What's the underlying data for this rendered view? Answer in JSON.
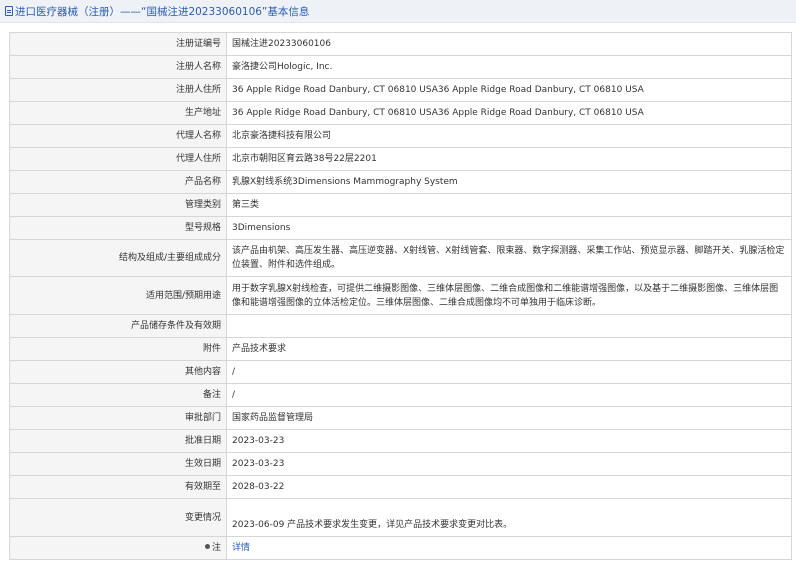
{
  "header": {
    "title": "进口医疗器械（注册）——“国械注进20233060106”基本信息"
  },
  "rows": [
    {
      "label": "注册证编号",
      "value": "国械注进20233060106"
    },
    {
      "label": "注册人名称",
      "value": "豪洛捷公司Hologic, Inc."
    },
    {
      "label": "注册人住所",
      "value": "36 Apple Ridge Road Danbury, CT 06810 USA36 Apple Ridge Road Danbury, CT 06810 USA"
    },
    {
      "label": "生产地址",
      "value": "36 Apple Ridge Road Danbury, CT 06810 USA36 Apple Ridge Road Danbury, CT 06810 USA"
    },
    {
      "label": "代理人名称",
      "value": "北京豪洛捷科技有限公司"
    },
    {
      "label": "代理人住所",
      "value": "北京市朝阳区育云路38号22层2201"
    },
    {
      "label": "产品名称",
      "value": "乳腺X射线系统3Dimensions Mammography System"
    },
    {
      "label": "管理类别",
      "value": "第三类"
    },
    {
      "label": "型号规格",
      "value": "3Dimensions"
    },
    {
      "label": "结构及组成/主要组成成分",
      "value": "该产品由机架、高压发生器、高压逆变器、X射线管、X射线管套、限束器、数字探测器、采集工作站、预览显示器、脚踏开关、乳腺活检定位装置、附件和选件组成。"
    },
    {
      "label": "适用范围/预期用途",
      "value": "用于数字乳腺X射线检查，可提供二维摄影图像、三维体层图像、二维合成图像和二维能谱增强图像，以及基于二维摄影图像、三维体层图像和能谱增强图像的立体活检定位。三维体层图像、二维合成图像均不可单独用于临床诊断。"
    },
    {
      "label": "产品储存条件及有效期",
      "value": ""
    },
    {
      "label": "附件",
      "value": "产品技术要求"
    },
    {
      "label": "其他内容",
      "value": "/"
    },
    {
      "label": "备注",
      "value": "/"
    },
    {
      "label": "审批部门",
      "value": "国家药品监督管理局"
    },
    {
      "label": "批准日期",
      "value": "2023-03-23"
    },
    {
      "label": "生效日期",
      "value": "2023-03-23"
    },
    {
      "label": "有效期至",
      "value": "2028-03-22"
    },
    {
      "label": "变更情况",
      "value": "2023-06-09 产品技术要求发生变更，详见产品技术要求变更对比表。"
    }
  ],
  "note": {
    "label": "注",
    "link": "详情",
    "icon": "pin-icon"
  }
}
